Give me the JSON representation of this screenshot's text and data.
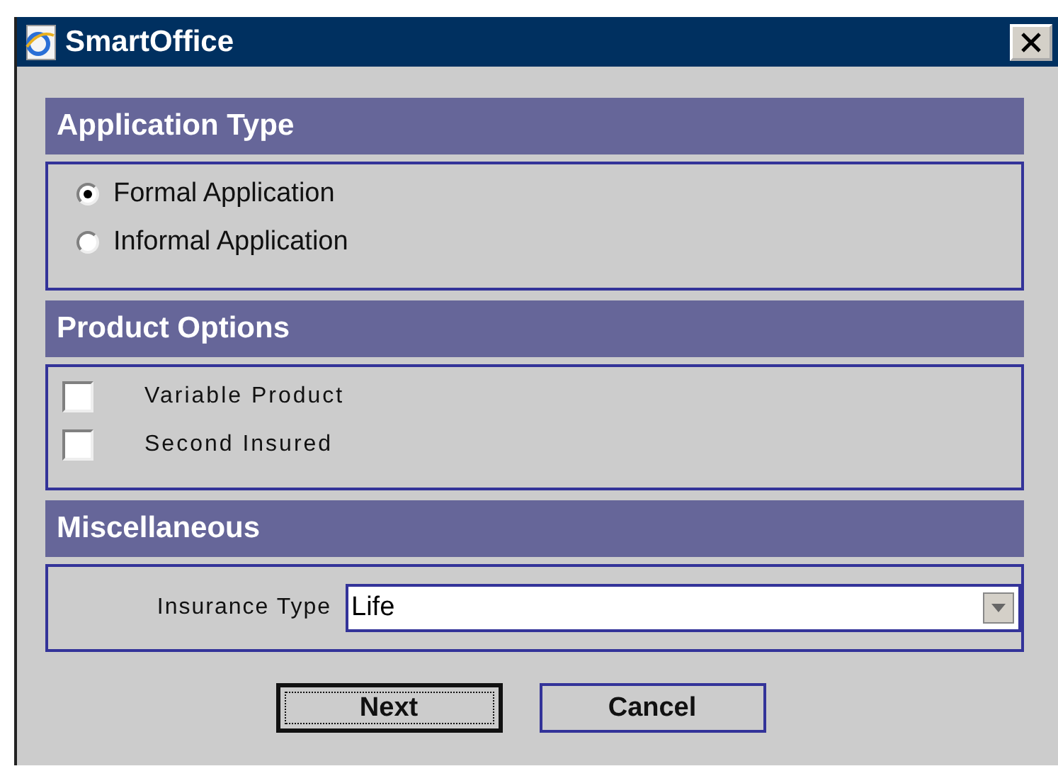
{
  "window": {
    "title": "SmartOffice"
  },
  "application_type": {
    "title": "Application Type",
    "options": [
      {
        "label": "Formal Application",
        "selected": true
      },
      {
        "label": "Informal Application",
        "selected": false
      }
    ]
  },
  "product_options": {
    "title": "Product Options",
    "options": [
      {
        "label": "Variable Product",
        "checked": false
      },
      {
        "label": "Second Insured",
        "checked": false
      }
    ]
  },
  "miscellaneous": {
    "title": "Miscellaneous",
    "insurance_type": {
      "label": "Insurance Type",
      "value": "Life"
    }
  },
  "buttons": [
    {
      "label": "Next",
      "focused": true
    },
    {
      "label": "Cancel",
      "focused": false
    }
  ]
}
